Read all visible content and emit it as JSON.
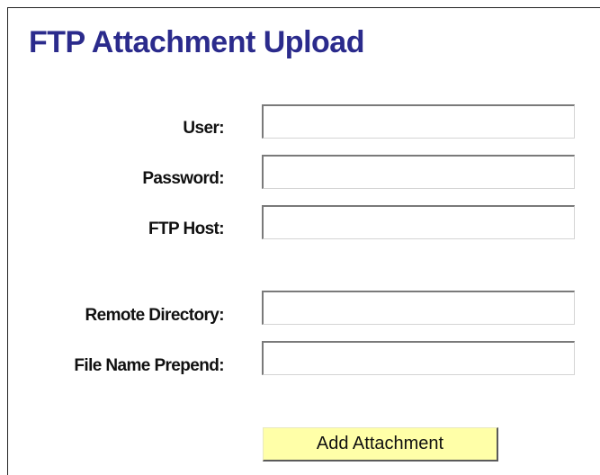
{
  "page": {
    "title": "FTP Attachment Upload"
  },
  "form": {
    "fields": [
      {
        "label": "User:",
        "value": ""
      },
      {
        "label": "Password:",
        "value": ""
      },
      {
        "label": "FTP Host:",
        "value": ""
      },
      {
        "label": "Remote Directory:",
        "value": ""
      },
      {
        "label": "File Name Prepend:",
        "value": ""
      }
    ],
    "submit_label": "Add Attachment"
  },
  "colors": {
    "title": "#2b2b8c",
    "button_background": "#ffffa8",
    "panel_border": "#222222"
  }
}
